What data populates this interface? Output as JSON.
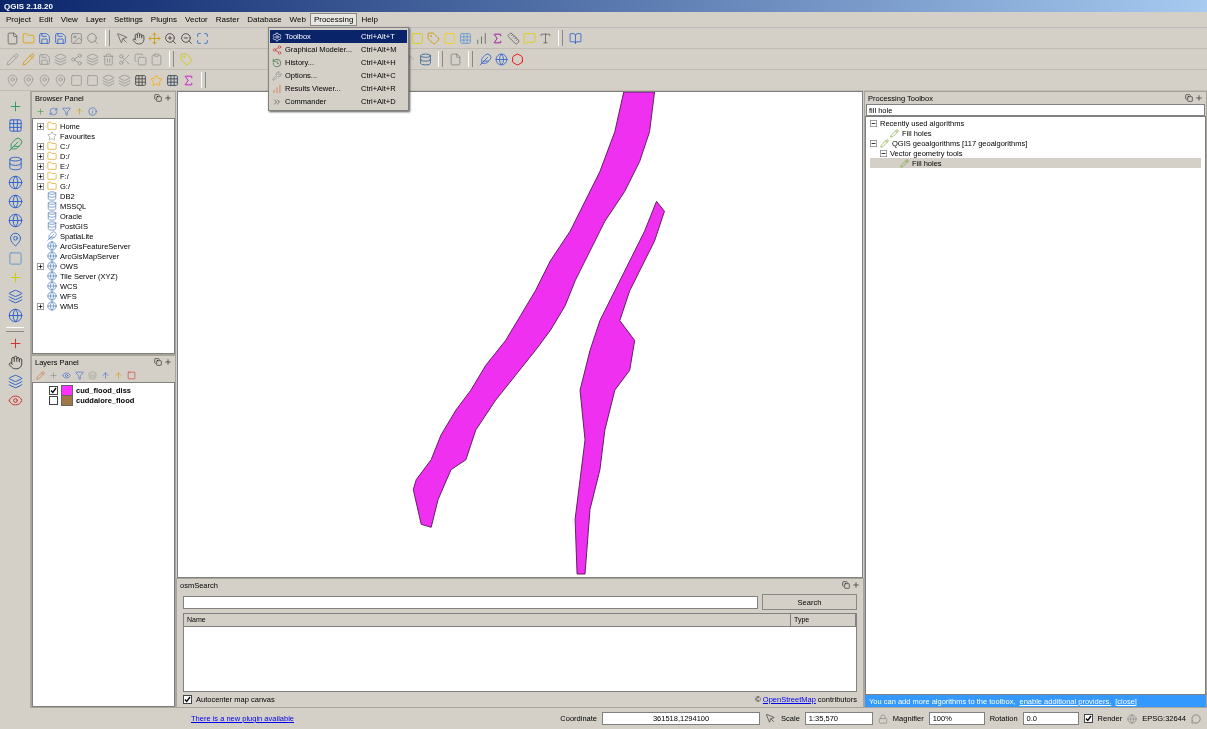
{
  "window": {
    "title": "QGIS 2.18.20"
  },
  "menu": [
    {
      "label": "Project",
      "selected": false
    },
    {
      "label": "Edit",
      "selected": false
    },
    {
      "label": "View",
      "selected": false
    },
    {
      "label": "Layer",
      "selected": false
    },
    {
      "label": "Settings",
      "selected": false
    },
    {
      "label": "Plugins",
      "selected": false
    },
    {
      "label": "Vector",
      "selected": false
    },
    {
      "label": "Raster",
      "selected": false
    },
    {
      "label": "Database",
      "selected": false
    },
    {
      "label": "Web",
      "selected": false
    },
    {
      "label": "Processing",
      "selected": true
    },
    {
      "label": "Help",
      "selected": false
    }
  ],
  "processing_menu": [
    {
      "label": "Toolbox",
      "shortcut": "Ctrl+Alt+T",
      "selected": true
    },
    {
      "label": "Graphical Modeler...",
      "shortcut": "Ctrl+Alt+M",
      "selected": false
    },
    {
      "label": "History...",
      "shortcut": "Ctrl+Alt+H",
      "selected": false
    },
    {
      "label": "Options...",
      "shortcut": "Ctrl+Alt+C",
      "selected": false
    },
    {
      "label": "Results Viewer...",
      "shortcut": "Ctrl+Alt+R",
      "selected": false
    },
    {
      "label": "Commander",
      "shortcut": "Ctrl+Alt+D",
      "selected": false
    }
  ],
  "browser_panel": {
    "title": "Browser Panel",
    "items": [
      {
        "label": "Home",
        "kind": "folder",
        "expanded": false
      },
      {
        "label": "Favourites",
        "kind": "star"
      },
      {
        "label": "C:/",
        "kind": "folder",
        "expanded": false
      },
      {
        "label": "D:/",
        "kind": "folder",
        "expanded": false
      },
      {
        "label": "E:/",
        "kind": "folder",
        "expanded": false
      },
      {
        "label": "F:/",
        "kind": "folder",
        "expanded": false
      },
      {
        "label": "G:/",
        "kind": "folder",
        "expanded": false
      },
      {
        "label": "DB2",
        "kind": "database"
      },
      {
        "label": "MSSQL",
        "kind": "database"
      },
      {
        "label": "Oracle",
        "kind": "database"
      },
      {
        "label": "PostGIS",
        "kind": "database"
      },
      {
        "label": "SpatiaLite",
        "kind": "feather"
      },
      {
        "label": "ArcGisFeatureServer",
        "kind": "globe"
      },
      {
        "label": "ArcGisMapServer",
        "kind": "globe"
      },
      {
        "label": "OWS",
        "kind": "globe",
        "expanded": false
      },
      {
        "label": "Tile Server (XYZ)",
        "kind": "globe"
      },
      {
        "label": "WCS",
        "kind": "globe"
      },
      {
        "label": "WFS",
        "kind": "globe"
      },
      {
        "label": "WMS",
        "kind": "globe",
        "expanded": false
      }
    ]
  },
  "layers_panel": {
    "title": "Layers Panel",
    "layers": [
      {
        "name": "cud_flood_diss",
        "checked": true,
        "color": "#ff33ff"
      },
      {
        "name": "cuddalore_flood",
        "checked": false,
        "color": "#a07848"
      }
    ]
  },
  "osm_search": {
    "title": "osmSearch",
    "search_button": "Search",
    "columns": [
      "Name",
      "Type"
    ],
    "autocenter": {
      "label": "Autocenter map canvas",
      "checked": true
    },
    "attribution_prefix": "©",
    "attribution_link": "OpenStreetMap",
    "attribution_suffix": "contributors"
  },
  "processing_toolbox": {
    "title": "Processing Toolbox",
    "search": "fill hole",
    "tree": [
      {
        "label": "Recently used algorithms",
        "kind": "group",
        "expanded": true,
        "selected": false,
        "children": [
          {
            "label": "Fill holes",
            "kind": "algorithm",
            "selected": false
          }
        ]
      },
      {
        "label": "QGIS geoalgorithms [117 geoalgorithms]",
        "kind": "provider",
        "expanded": true,
        "selected": false,
        "children": [
          {
            "label": "Vector geometry tools",
            "kind": "group",
            "expanded": true,
            "selected": false,
            "children": [
              {
                "label": "Fill holes",
                "kind": "algorithm",
                "selected": true
              }
            ]
          }
        ]
      }
    ],
    "notice": {
      "text": "You can add more algorithms to the toolbox,",
      "link": "enable additional providers.",
      "close": "[close]"
    }
  },
  "status_bar": {
    "plugin_notice": "There is a new plugin available",
    "coordinate_label": "Coordinate",
    "coordinate": "361518,1294100",
    "scale_label": "Scale",
    "scale": "1:35,570",
    "magnifier_label": "Magnifier",
    "magnifier": "100%",
    "rotation_label": "Rotation",
    "rotation": "0.0",
    "render": {
      "label": "Render",
      "checked": true
    },
    "crs": "EPSG:32644"
  }
}
